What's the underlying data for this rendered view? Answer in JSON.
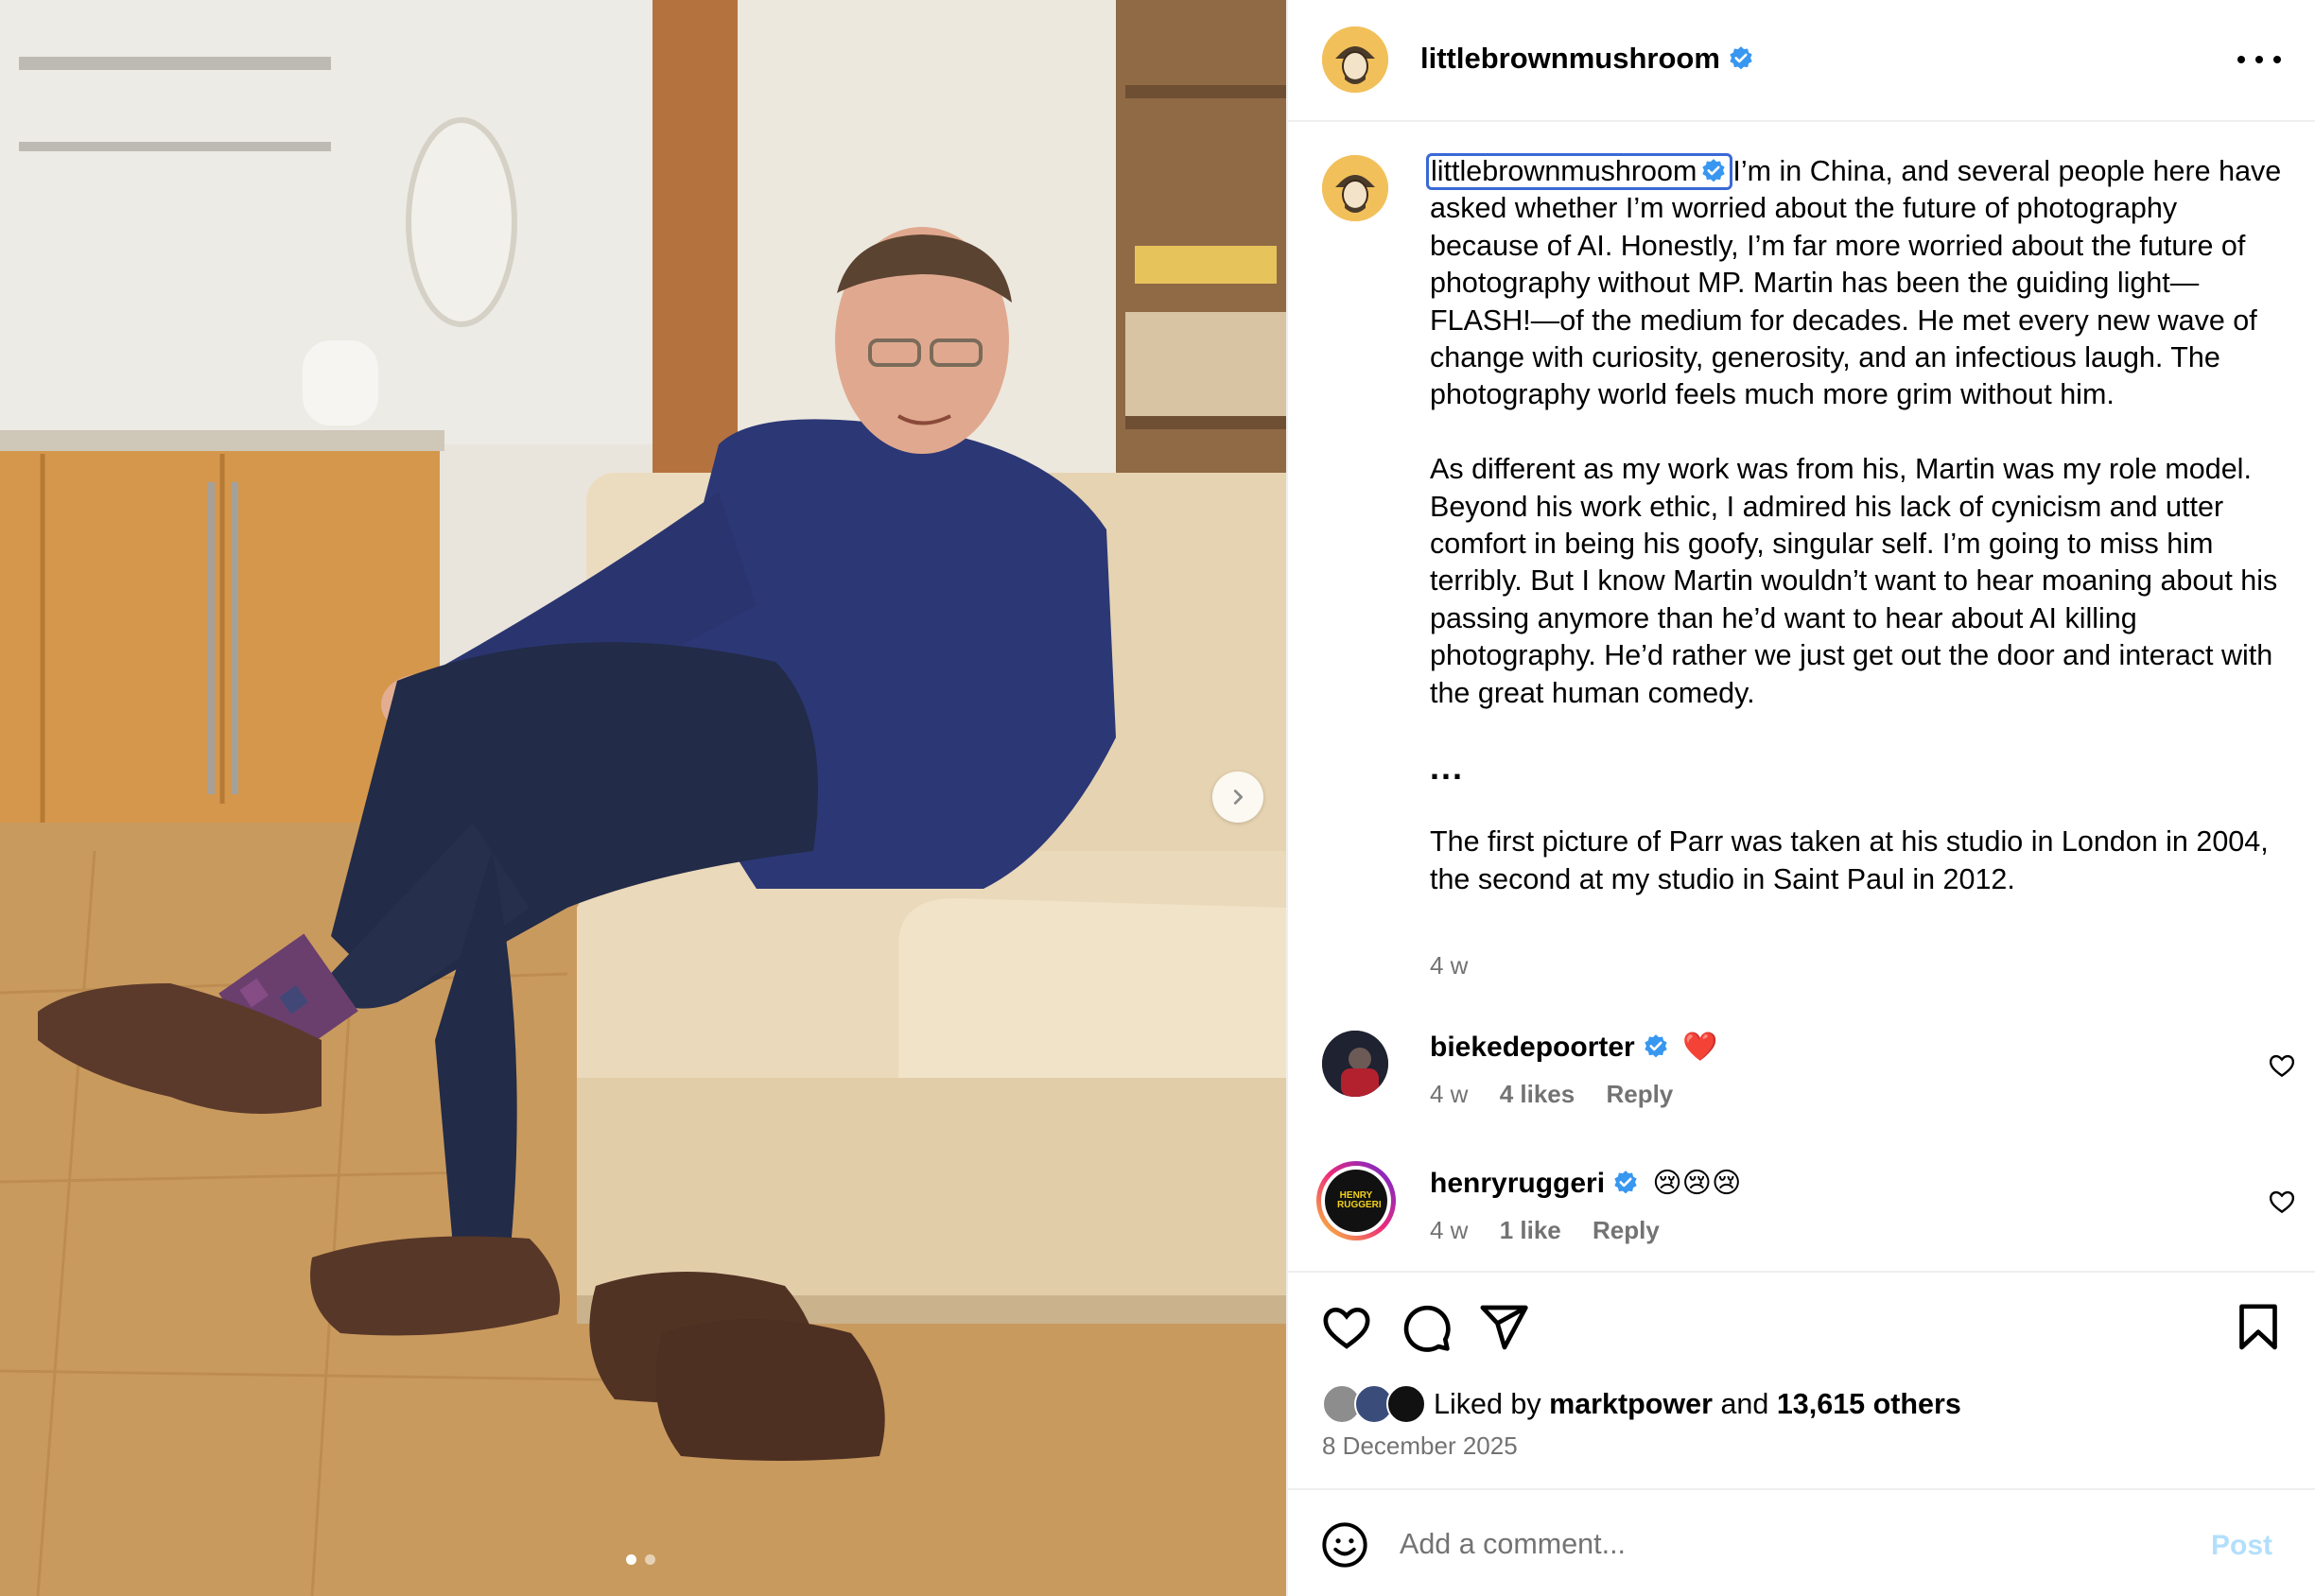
{
  "colors": {
    "accent": "#0095f6",
    "verified": "#3897f0",
    "muted": "#737373",
    "highlight": "#3a68d6"
  },
  "header": {
    "username": "littlebrownmushroom",
    "more_icon": "more-horizontal-icon"
  },
  "caption": {
    "username": "littlebrownmushroom",
    "paragraph1": "I’m in China, and several people here have asked whether I’m worried about the future of photography because of AI. Honestly, I’m far more worried about the future of photography without MP. Martin has been the guiding light—FLASH!—of the medium for decades. He met every new wave of change with curiosity, generosity, and an infectious laugh. The photography world feels much more grim without him.",
    "paragraph2": "As different as my work was from his, Martin was my role model. Beyond his work ethic, I admired his lack of cynicism and utter comfort in being his goofy, singular self. I’m going to miss him terribly. But I know Martin wouldn’t want to hear moaning about his passing anymore than he’d want to hear about AI killing photography. He’d rather we just get out the door and interact with the great human comedy.",
    "ellipsis": "...",
    "paragraph3": "The first picture of Parr was taken at his studio in London in 2004, the second at my studio in Saint Paul in 2012.",
    "time": "4 w"
  },
  "comments": [
    {
      "username": "biekedepoorter",
      "text": "❤️",
      "time": "4 w",
      "likes": "4 likes",
      "reply": "Reply"
    },
    {
      "username": "henryruggeri",
      "text": "😢😢😢",
      "time": "4 w",
      "likes": "1 like",
      "reply": "Reply",
      "avatar_text": "HENRY RUGGERI"
    }
  ],
  "actions": {
    "like_icon": "heart-icon",
    "comment_icon": "comment-icon",
    "share_icon": "send-icon",
    "save_icon": "bookmark-icon"
  },
  "likes": {
    "prefix": "Liked by",
    "user": "marktpower",
    "joiner": "and",
    "others": "13,615 others"
  },
  "date": "8 December 2025",
  "composer": {
    "placeholder": "Add a comment...",
    "post_label": "Post"
  },
  "carousel": {
    "slides": 2,
    "current": 1
  }
}
